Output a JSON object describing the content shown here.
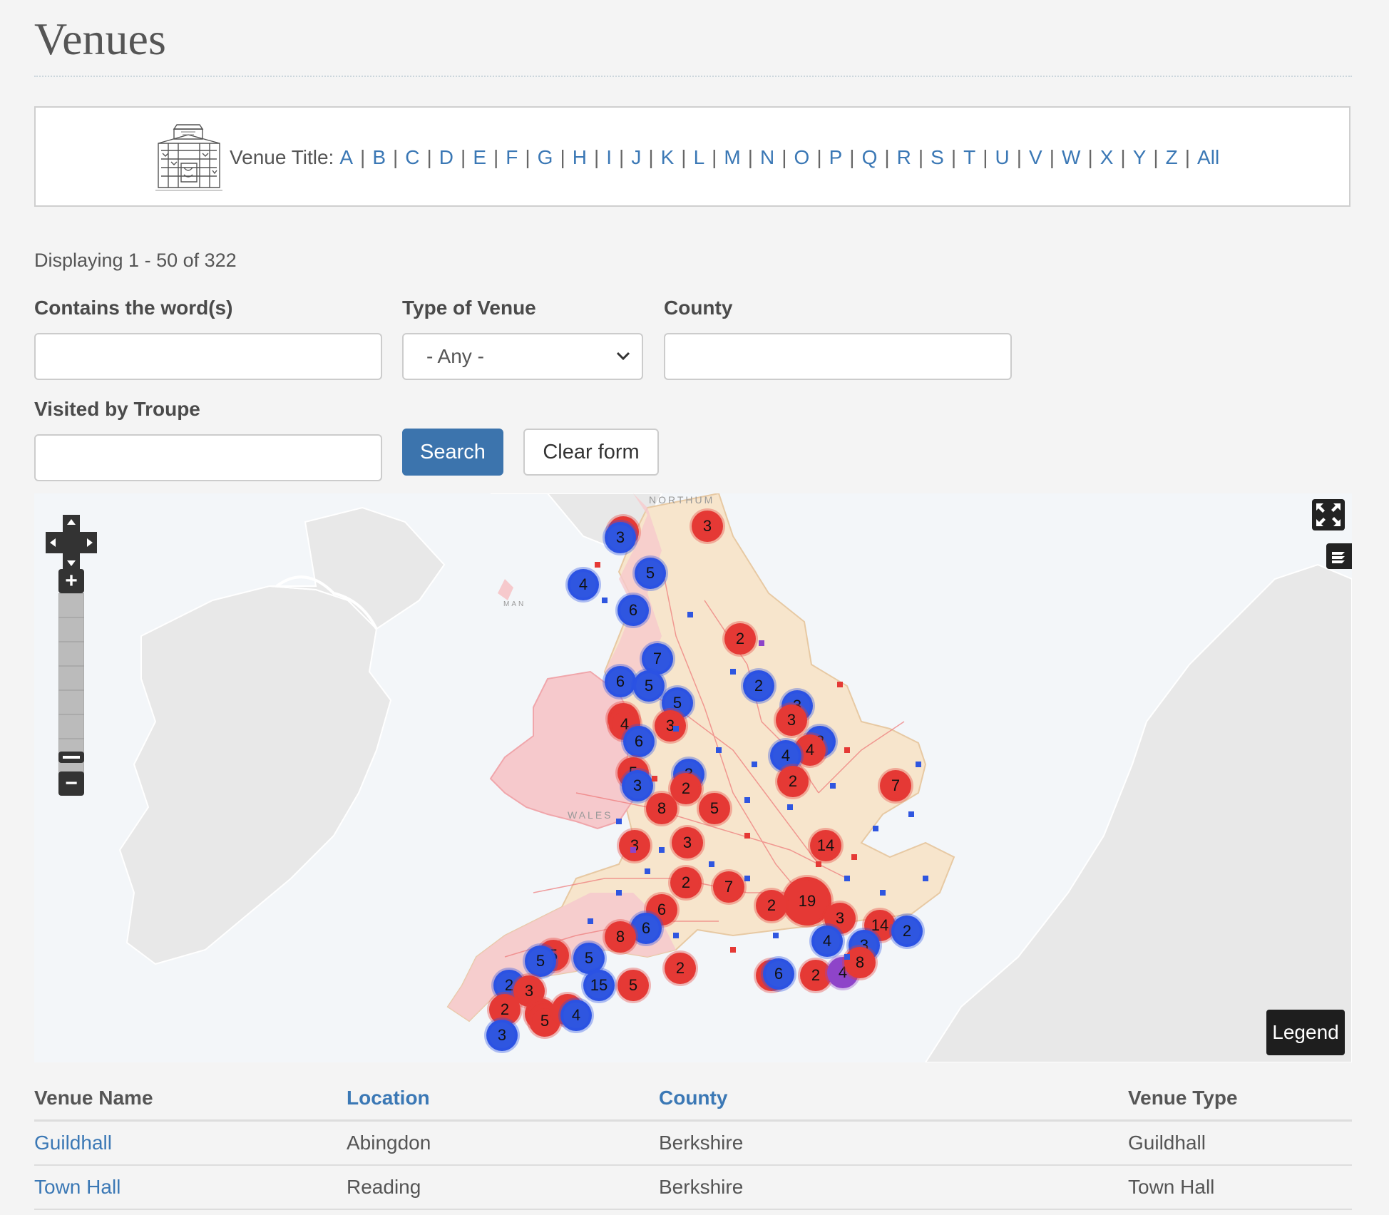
{
  "page": {
    "title": "Venues"
  },
  "alpha_filter": {
    "label": "Venue Title:",
    "letters": [
      "A",
      "B",
      "C",
      "D",
      "E",
      "F",
      "G",
      "H",
      "I",
      "J",
      "K",
      "L",
      "M",
      "N",
      "O",
      "P",
      "Q",
      "R",
      "S",
      "T",
      "U",
      "V",
      "W",
      "X",
      "Y",
      "Z",
      "All"
    ]
  },
  "results_summary": "Displaying 1 - 50 of 322",
  "filters": {
    "words_label": "Contains the word(s)",
    "words_value": "",
    "type_label": "Type of Venue",
    "type_value": "- Any -",
    "county_label": "County",
    "county_value": "",
    "troupe_label": "Visited by Troupe",
    "troupe_value": "",
    "search_label": "Search",
    "clear_label": "Clear form"
  },
  "map": {
    "legend_label": "Legend",
    "map_labels": [
      "WALES",
      "NORTHUM",
      "MAN"
    ],
    "colors": {
      "red": "#e53935",
      "blue": "#2f56e0",
      "purple": "#8e44c9",
      "land_england": "#f7e5cc",
      "land_wales": "#f6c9cc",
      "sea": "#f3f6f9"
    },
    "markers": [
      {
        "n": "3",
        "c": "red"
      },
      {
        "n": "3",
        "c": "red"
      },
      {
        "n": "3",
        "c": "blue"
      },
      {
        "n": "4",
        "c": "blue"
      },
      {
        "n": "5",
        "c": "blue"
      },
      {
        "n": "6",
        "c": "blue"
      },
      {
        "n": "2",
        "c": "red"
      },
      {
        "n": "7",
        "c": "blue"
      },
      {
        "n": "6",
        "c": "blue"
      },
      {
        "n": "5",
        "c": "blue"
      },
      {
        "n": "2",
        "c": "blue"
      },
      {
        "n": "5",
        "c": "blue"
      },
      {
        "n": "2",
        "c": "red"
      },
      {
        "n": "4",
        "c": "red"
      },
      {
        "n": "3",
        "c": "red"
      },
      {
        "n": "3",
        "c": "blue"
      },
      {
        "n": "3",
        "c": "red"
      },
      {
        "n": "2",
        "c": "blue"
      },
      {
        "n": "4",
        "c": "red"
      },
      {
        "n": "6",
        "c": "blue"
      },
      {
        "n": "4",
        "c": "blue"
      },
      {
        "n": "5",
        "c": "red"
      },
      {
        "n": "3",
        "c": "blue"
      },
      {
        "n": "3",
        "c": "blue"
      },
      {
        "n": "2",
        "c": "red"
      },
      {
        "n": "2",
        "c": "red"
      },
      {
        "n": "7",
        "c": "red"
      },
      {
        "n": "8",
        "c": "red"
      },
      {
        "n": "5",
        "c": "red"
      },
      {
        "n": "3",
        "c": "red"
      },
      {
        "n": "3",
        "c": "red"
      },
      {
        "n": "14",
        "c": "red"
      },
      {
        "n": "2",
        "c": "red"
      },
      {
        "n": "7",
        "c": "red"
      },
      {
        "n": "19",
        "c": "red"
      },
      {
        "n": "2",
        "c": "red"
      },
      {
        "n": "6",
        "c": "red"
      },
      {
        "n": "3",
        "c": "red"
      },
      {
        "n": "14",
        "c": "red"
      },
      {
        "n": "2",
        "c": "blue"
      },
      {
        "n": "6",
        "c": "blue"
      },
      {
        "n": "8",
        "c": "red"
      },
      {
        "n": "4",
        "c": "blue"
      },
      {
        "n": "3",
        "c": "blue"
      },
      {
        "n": "5",
        "c": "red"
      },
      {
        "n": "5",
        "c": "blue"
      },
      {
        "n": "5",
        "c": "blue"
      },
      {
        "n": "2",
        "c": "red"
      },
      {
        "n": "2",
        "c": "red"
      },
      {
        "n": "6",
        "c": "blue"
      },
      {
        "n": "2",
        "c": "red"
      },
      {
        "n": "4",
        "c": "purple"
      },
      {
        "n": "8",
        "c": "red"
      },
      {
        "n": "2",
        "c": "blue"
      },
      {
        "n": "3",
        "c": "red"
      },
      {
        "n": "15",
        "c": "blue"
      },
      {
        "n": "5",
        "c": "red"
      },
      {
        "n": "2",
        "c": "red"
      },
      {
        "n": "4",
        "c": "red"
      },
      {
        "n": "5",
        "c": "red"
      },
      {
        "n": "8",
        "c": "red"
      },
      {
        "n": "4",
        "c": "blue"
      },
      {
        "n": "3",
        "c": "blue"
      }
    ]
  },
  "table": {
    "headers": [
      "Venue Name",
      "Location",
      "County",
      "Venue Type"
    ],
    "rows": [
      {
        "name": "Guildhall",
        "location": "Abingdon",
        "county": "Berkshire",
        "type": "Guildhall"
      },
      {
        "name": "Town Hall",
        "location": "Reading",
        "county": "Berkshire",
        "type": "Town Hall"
      }
    ]
  }
}
